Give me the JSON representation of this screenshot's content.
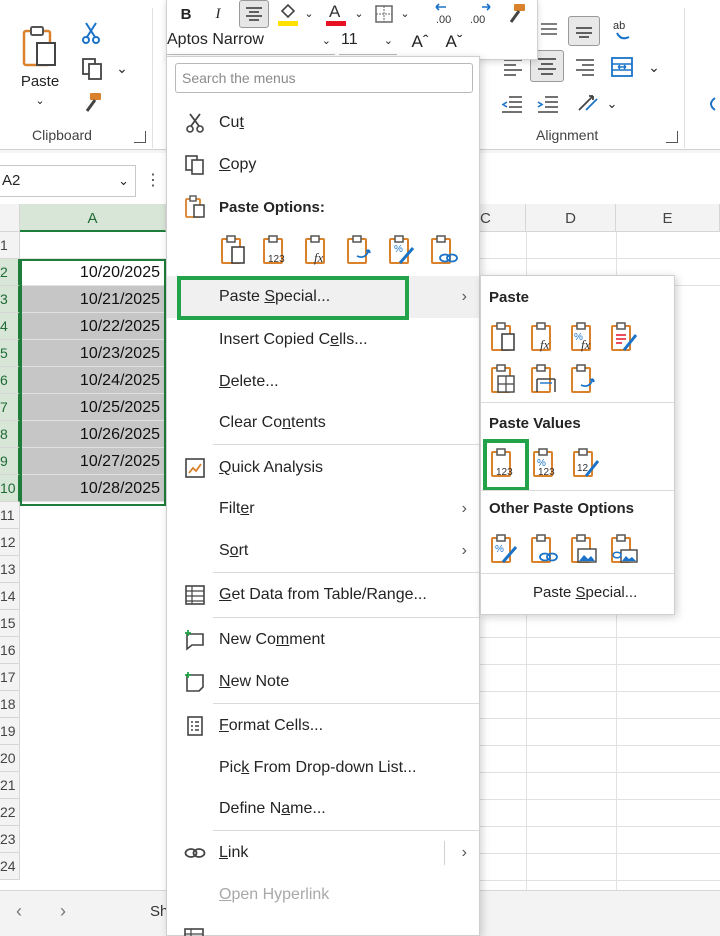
{
  "ribbon": {
    "clipboard": {
      "paste_label": "Paste",
      "group_label": "Clipboard"
    },
    "alignment": {
      "group_label": "Alignment"
    }
  },
  "mini_toolbar": {
    "bold": "B",
    "italic": "I",
    "font_name": "Aptos Narrow",
    "font_size": "11",
    "grow_font": "Aˆ",
    "shrink_font": "Aˇ",
    "font_color": "#e81123",
    "fill_color": "#ffe100"
  },
  "namebox": {
    "value": "A2"
  },
  "grid": {
    "columns": [
      "A",
      "D",
      "E"
    ],
    "selected_column": "A",
    "row_numbers": [
      "1",
      "2",
      "3",
      "4",
      "5",
      "6",
      "7",
      "8",
      "9",
      "10",
      "11",
      "12",
      "13",
      "14",
      "15",
      "16",
      "17",
      "18",
      "19",
      "20",
      "21",
      "22",
      "23",
      "24"
    ],
    "dates": [
      "10/20/2025",
      "10/21/2025",
      "10/22/2025",
      "10/23/2025",
      "10/24/2025",
      "10/25/2025",
      "10/26/2025",
      "10/27/2025",
      "10/28/2025"
    ],
    "sheet_name_partial": "Sh"
  },
  "context_menu": {
    "search_placeholder": "Search the menus",
    "cut": {
      "pre": "Cu",
      "u": "t",
      "post": ""
    },
    "copy": {
      "pre": "",
      "u": "C",
      "post": "opy"
    },
    "paste_options_heading": "Paste Options:",
    "paste_special": {
      "pre": "Paste ",
      "u": "S",
      "post": "pecial..."
    },
    "insert_copied": {
      "pre": "Insert Copied C",
      "u": "e",
      "post": "lls..."
    },
    "delete": {
      "pre": "",
      "u": "D",
      "post": "elete..."
    },
    "clear_contents": {
      "pre": "Clear Co",
      "u": "n",
      "post": "tents"
    },
    "quick_analysis": {
      "pre": "",
      "u": "Q",
      "post": "uick Analysis"
    },
    "filter": {
      "pre": "Filt",
      "u": "e",
      "post": "r"
    },
    "sort": {
      "pre": "S",
      "u": "o",
      "post": "rt"
    },
    "get_data": {
      "pre": "",
      "u": "G",
      "post": "et Data from Table/Range..."
    },
    "new_comment": {
      "pre": "New Co",
      "u": "m",
      "post": "ment"
    },
    "new_note": {
      "pre": "",
      "u": "N",
      "post": "ew Note"
    },
    "format_cells": {
      "pre": "",
      "u": "F",
      "post": "ormat Cells..."
    },
    "pick_dropdown": {
      "pre": "Pic",
      "u": "k",
      "post": " From Drop-down List..."
    },
    "define_name": {
      "pre": "Define N",
      "u": "a",
      "post": "me..."
    },
    "link": {
      "pre": "",
      "u": "L",
      "post": "ink"
    },
    "open_hyperlink": {
      "pre": "",
      "u": "O",
      "post": "pen Hyperlink"
    }
  },
  "submenu": {
    "paste_heading": "Paste",
    "paste_values_heading": "Paste Values",
    "other_heading": "Other Paste Options",
    "paste_special": {
      "pre": "Paste ",
      "u": "S",
      "post": "pecial..."
    }
  },
  "colors": {
    "accent_green": "#22a34a",
    "excel_green": "#1e7d3a",
    "clipboard_orange": "#d9822b",
    "icon_blue": "#1a73c9"
  }
}
